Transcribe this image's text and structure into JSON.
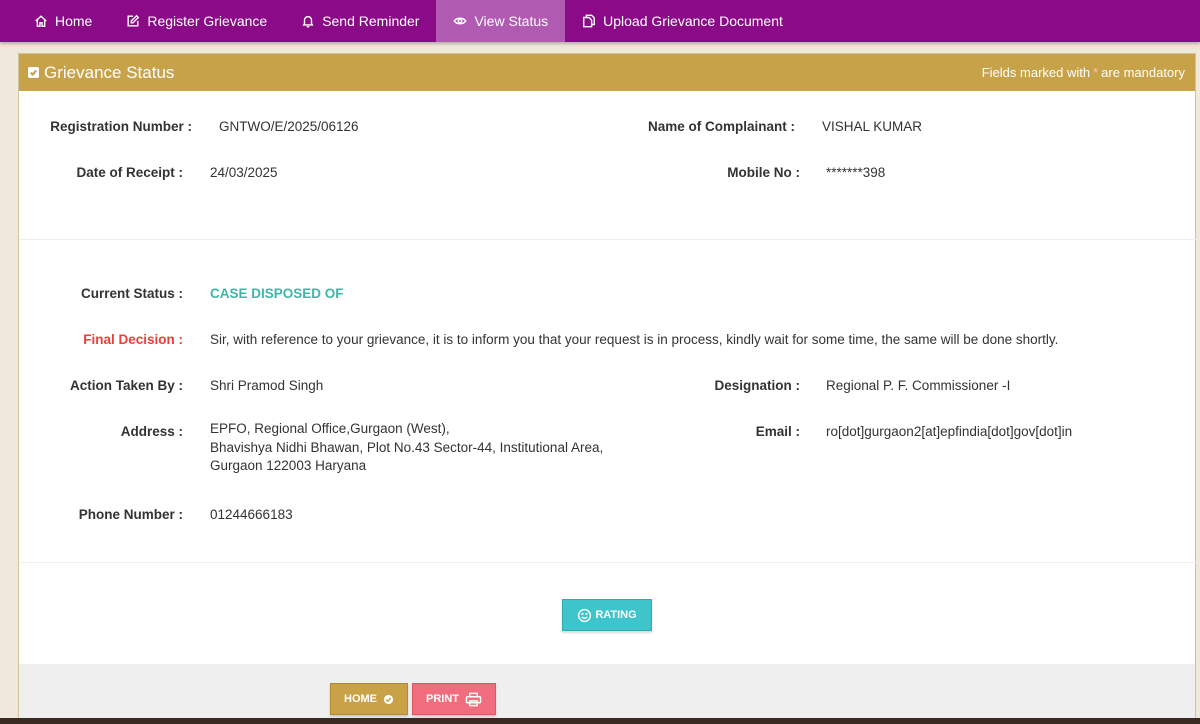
{
  "nav": {
    "items": [
      {
        "label": "Home",
        "icon": "home-icon"
      },
      {
        "label": "Register Grievance",
        "icon": "edit-icon"
      },
      {
        "label": "Send Reminder",
        "icon": "bell-icon"
      },
      {
        "label": "View Status",
        "icon": "eye-icon",
        "active": true
      },
      {
        "label": "Upload Grievance Document",
        "icon": "documents-icon"
      }
    ]
  },
  "panel": {
    "title": "Grievance Status",
    "mandatory_prefix": "Fields marked with",
    "mandatory_star": "*",
    "mandatory_suffix": "are mandatory"
  },
  "details": {
    "registration_number_label": "Registration Number :",
    "registration_number": "GNTWO/E/2025/06126",
    "complainant_label": "Name of Complainant :",
    "complainant": "VISHAL KUMAR",
    "date_label": "Date of Receipt :",
    "date": "24/03/2025",
    "mobile_label": "Mobile No :",
    "mobile": "*******398",
    "current_status_label": "Current Status :",
    "current_status": "CASE DISPOSED OF",
    "final_decision_label": "Final Decision :",
    "final_decision": "Sir, with reference to your grievance, it is to inform you that your request is in process, kindly wait for some time, the same will be done shortly.",
    "action_taken_label": "Action Taken By :",
    "action_taken": "Shri Pramod Singh",
    "designation_label": "Designation :",
    "designation": "Regional P. F. Commissioner -I",
    "address_label": "Address :",
    "address_lines": [
      "EPFO, Regional Office,Gurgaon (West),",
      "Bhavishya Nidhi Bhawan, Plot No.43 Sector-44, Institutional Area,",
      "Gurgaon 122003 Haryana"
    ],
    "email_label": "Email :",
    "email": "ro[dot]gurgaon2[at]epfindia[dot]gov[dot]in",
    "phone_label": "Phone Number :",
    "phone": "01244666183"
  },
  "buttons": {
    "rating": "RATING",
    "home": "HOME",
    "print": "PRINT"
  },
  "colors": {
    "nav": "#8b0a87",
    "nav_active": "#b05ab2",
    "panel_header": "#c8a248",
    "status": "#3fb6a8",
    "final_decision_label": "#e8403a",
    "rating_button": "#3ec5cc",
    "home_button": "#c9a146",
    "print_button": "#ef6d7c"
  }
}
